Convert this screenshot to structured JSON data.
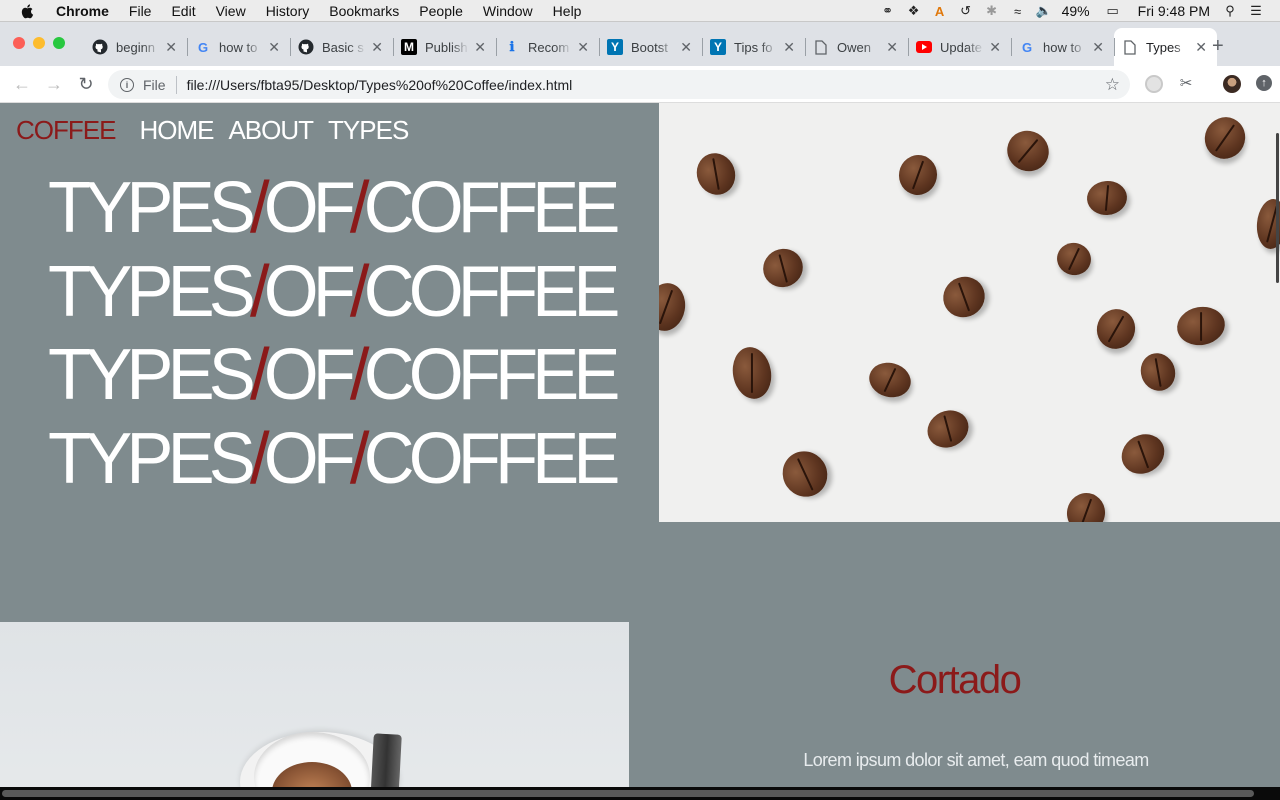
{
  "menubar": {
    "app": "Chrome",
    "items": [
      "File",
      "Edit",
      "View",
      "History",
      "Bookmarks",
      "People",
      "Window",
      "Help"
    ],
    "battery": "49%",
    "clock": "Fri 9:48 PM"
  },
  "tabs": [
    {
      "title": "beginn",
      "icon": "github-icon"
    },
    {
      "title": "how to",
      "icon": "google-icon"
    },
    {
      "title": "Basic s",
      "icon": "github-icon"
    },
    {
      "title": "Publish",
      "icon": "medium-icon"
    },
    {
      "title": "Recom",
      "icon": "info-icon"
    },
    {
      "title": "Bootst",
      "icon": "yoast-icon"
    },
    {
      "title": "Tips fo",
      "icon": "yoast-icon"
    },
    {
      "title": "Owen",
      "icon": "page-icon"
    },
    {
      "title": "Update",
      "icon": "youtube-icon"
    },
    {
      "title": "how to",
      "icon": "google-icon"
    },
    {
      "title": "Types",
      "icon": "page-icon",
      "active": true
    }
  ],
  "toolbar": {
    "chip": "File",
    "url": "file:///Users/fbta95/Desktop/Types%20of%20Coffee/index.html"
  },
  "site": {
    "brand": "COFFEE",
    "nav": [
      "HOME",
      "ABOUT",
      "TYPES"
    ],
    "hero": {
      "word1": "TYPES",
      "slash": "/",
      "word2": "OF",
      "word3": "COFFEE"
    },
    "detail_title": "Cortado",
    "detail_body": "Lorem ipsum dolor sit amet, eam quod timeam concludaturque ad, fabellas suavitate gubergren sed"
  },
  "colors": {
    "accent": "#8b1a1a",
    "page_bg": "#7f8b8e"
  }
}
